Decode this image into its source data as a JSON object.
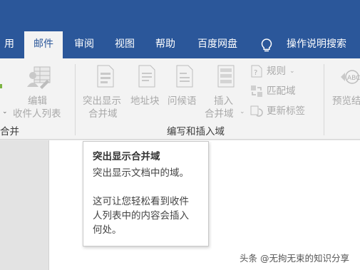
{
  "tabs": [
    {
      "label": "用"
    },
    {
      "label": "邮件"
    },
    {
      "label": "审阅"
    },
    {
      "label": "视图"
    },
    {
      "label": "帮助"
    },
    {
      "label": "百度网盘"
    },
    {
      "label": "操作说明搜索"
    }
  ],
  "ribbon": {
    "edit_recipients": {
      "line1": "编辑",
      "line2": "收件人列表"
    },
    "left_group_label": "合并",
    "highlight_fields": {
      "line1": "突出显示",
      "line2": "合并域"
    },
    "address_block": {
      "label": "地址块"
    },
    "greeting_line": {
      "label": "问候语"
    },
    "insert_field": {
      "line1": "插入",
      "line2": "合并域"
    },
    "rules": {
      "label": "规则"
    },
    "match_fields": {
      "label": "匹配域"
    },
    "update_labels": {
      "label": "更新标签"
    },
    "group_label": "编写和插入域",
    "preview": {
      "label": "预览结"
    }
  },
  "tooltip": {
    "title": "突出显示合并域",
    "line1": "突出显示文档中的域。",
    "line2": "这可让您轻松看到收件",
    "line3": "人列表中的内容会插入",
    "line4": "何处。"
  },
  "watermark": "头条 @无拘无束的知识分享",
  "colors": {
    "accent": "#2b579a",
    "ribbon": "#f3f3f3",
    "disabled_text": "#a9a9a9"
  }
}
